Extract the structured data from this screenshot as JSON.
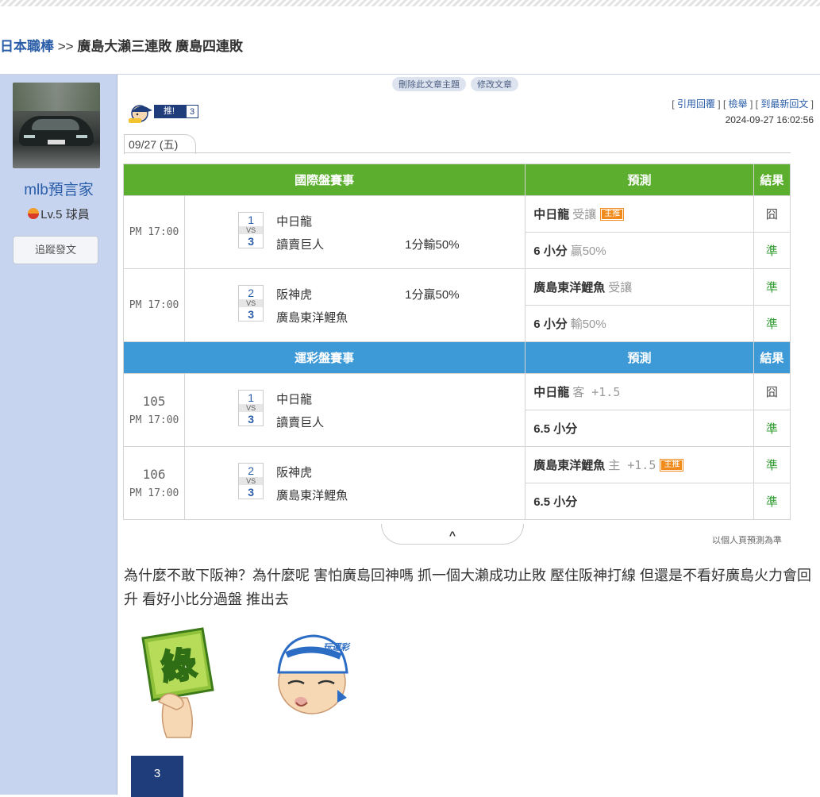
{
  "breadcrumb": {
    "forum": "日本職棒",
    "separator": " >> ",
    "title": "廣島大瀨三連敗 廣島四連敗"
  },
  "user": {
    "name": "mlb預言家",
    "level": "Lv.5 球員",
    "follow_label": "追蹤發文"
  },
  "mod": {
    "delete_label": "刪除此文章主題",
    "edit_label": "修改文章"
  },
  "push": {
    "label": "推!",
    "count": "3"
  },
  "reply_links": {
    "quote": "引用回覆",
    "report": "檢舉",
    "latest": "到最新回文"
  },
  "post_time": "2024-09-27 16:02:56",
  "date_tab": "09/27 (五)",
  "section1": {
    "header_match": "國際盤賽事",
    "header_pred": "預測",
    "header_result": "結果"
  },
  "section2": {
    "header_match": "運彩盤賽事",
    "header_pred": "預測",
    "header_result": "結果"
  },
  "intl_games": [
    {
      "time": "PM 17:00",
      "score1": "1",
      "vs": "VS",
      "score2": "3",
      "team1": "中日龍",
      "team2": "讀賣巨人",
      "handicap": "1分輸50%",
      "pred1_team": "中日龍",
      "pred1_extra": "受讓",
      "pred1_badge": "主推",
      "result1": "囧",
      "pred2_team": "6 小分",
      "pred2_extra": "贏50%",
      "result2": "準"
    },
    {
      "time": "PM 17:00",
      "score1": "2",
      "vs": "VS",
      "score2": "3",
      "team1": "阪神虎",
      "team2": "廣島東洋鯉魚",
      "handicap": "1分贏50%",
      "pred1_team": "廣島東洋鯉魚",
      "pred1_extra": "受讓",
      "result1": "準",
      "pred2_team": "6 小分",
      "pred2_extra": "輸50%",
      "result2": "準"
    }
  ],
  "lottery_games": [
    {
      "game_no": "105",
      "time": "PM 17:00",
      "score1": "1",
      "vs": "VS",
      "score2": "3",
      "team1": "中日龍",
      "team2": "讀賣巨人",
      "pred1_team": "中日龍",
      "pred1_extra": "客 +1.5",
      "result1": "囧",
      "pred2_team": "6.5 小分",
      "result2": "準"
    },
    {
      "game_no": "106",
      "time": "PM 17:00",
      "score1": "2",
      "vs": "VS",
      "score2": "3",
      "team1": "阪神虎",
      "team2": "廣島東洋鯉魚",
      "pred1_team": "廣島東洋鯉魚",
      "pred1_extra": "主 +1.5",
      "pred1_badge": "主推",
      "result1": "準",
      "pred2_team": "6.5 小分",
      "result2": "準"
    }
  ],
  "footnote": "以個人頁預測為準",
  "post_text": "為什麼不敢下阪神？為什麼呢 害怕廣島回神嗎 抓一個大瀨成功止敗 壓住阪神打線 但還是不看好廣島火力會回升 看好小比分過盤 推出去",
  "sticker1_text": "綠",
  "sticker2_text": "玩運彩",
  "bottom_badge": "3",
  "colors": {
    "green_header": "#5cae2e",
    "blue_header": "#3d9ad6",
    "link": "#2a5da8",
    "win": "#2e9b2e",
    "badge": "#f08a1a",
    "sidebar": "#c6d4f0"
  }
}
